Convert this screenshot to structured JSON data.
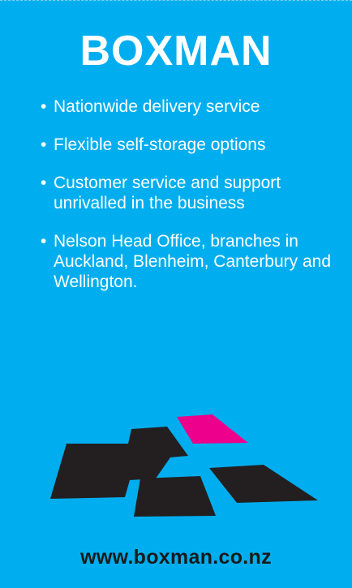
{
  "brand": "BOXMAN",
  "bullet_symbol": "•",
  "bullets": [
    "Nationwide delivery service",
    "Flexible self-storage options",
    "Customer service and support unrivalled in the business",
    "Nelson Head Office, branches in Auckland, Blenheim, Canterbury and Wellington."
  ],
  "website": "www.boxman.co.nz",
  "colors": {
    "background": "#00aeef",
    "text": "#ffffff",
    "logo_dark": "#231f20",
    "logo_accent": "#ec008c"
  }
}
